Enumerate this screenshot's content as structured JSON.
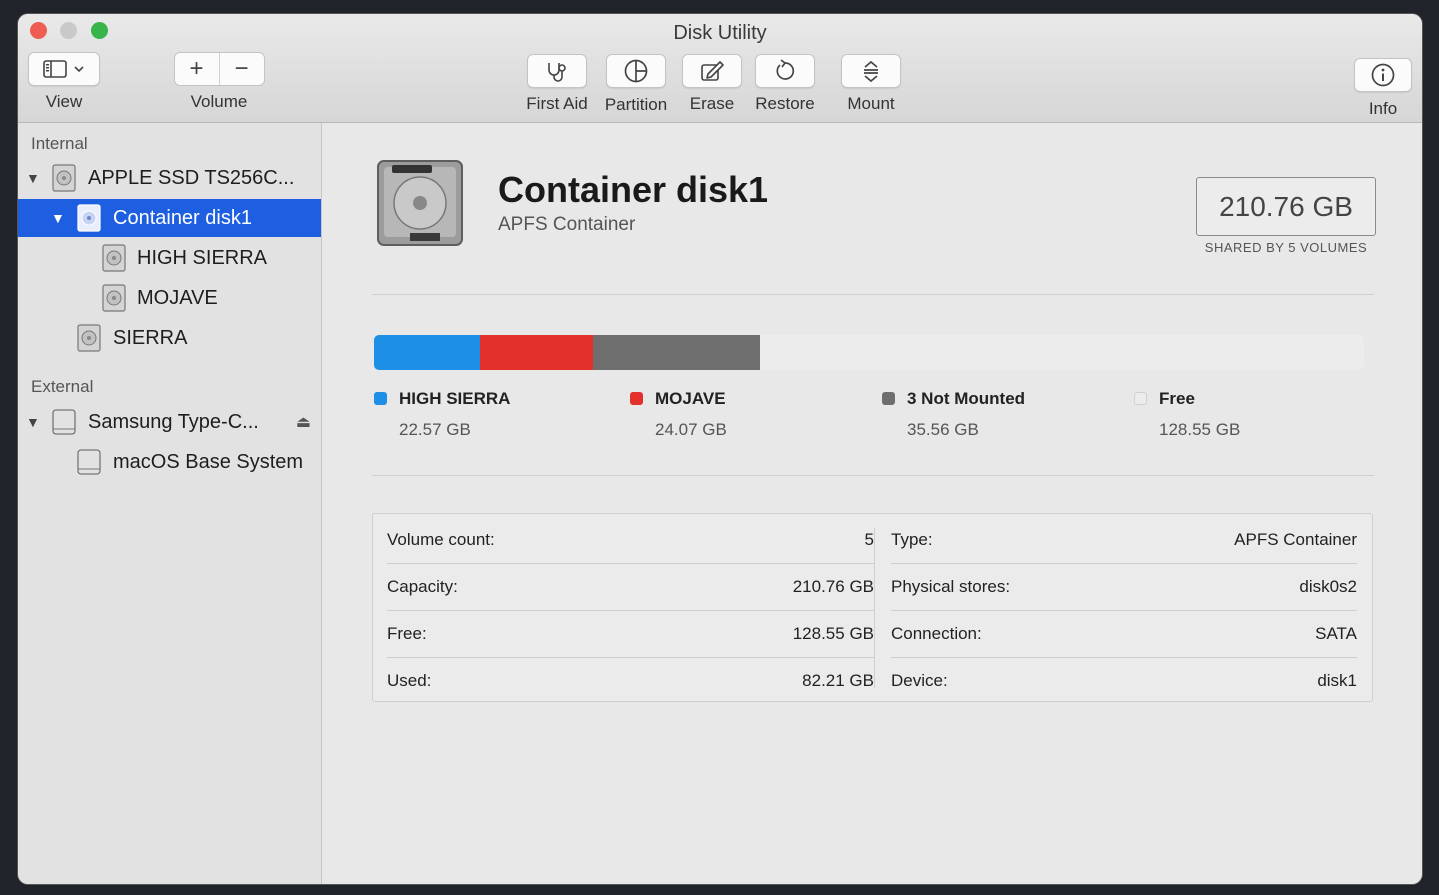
{
  "window": {
    "title": "Disk Utility"
  },
  "toolbar": {
    "view_label": "View",
    "volume_label": "Volume",
    "volume_add": "+",
    "volume_remove": "−",
    "first_aid_label": "First Aid",
    "partition_label": "Partition",
    "erase_label": "Erase",
    "restore_label": "Restore",
    "mount_label": "Mount",
    "info_label": "Info"
  },
  "sidebar": {
    "internal_header": "Internal",
    "external_header": "External",
    "items": [
      {
        "label": "APPLE SSD TS256C..."
      },
      {
        "label": "Container disk1"
      },
      {
        "label": "HIGH SIERRA"
      },
      {
        "label": "MOJAVE"
      },
      {
        "label": "SIERRA"
      },
      {
        "label": "Samsung Type-C..."
      },
      {
        "label": "macOS Base System"
      }
    ]
  },
  "header": {
    "name": "Container disk1",
    "subtitle": "APFS Container",
    "capacity": "210.76 GB",
    "capacity_note": "SHARED BY 5 VOLUMES"
  },
  "usage": {
    "total_gb": 210.76,
    "segments": [
      {
        "name": "HIGH SIERRA",
        "value": "22.57 GB",
        "gb": 22.57,
        "color": "#1e8fe6"
      },
      {
        "name": "MOJAVE",
        "value": "24.07 GB",
        "gb": 24.07,
        "color": "#e4302a"
      },
      {
        "name": "3 Not Mounted",
        "value": "35.56 GB",
        "gb": 35.56,
        "color": "#6e6e6e"
      },
      {
        "name": "Free",
        "value": "128.55 GB",
        "gb": 128.55,
        "color": "#ececec"
      }
    ]
  },
  "info": {
    "left": [
      {
        "label": "Volume count:",
        "value": "5"
      },
      {
        "label": "Capacity:",
        "value": "210.76 GB"
      },
      {
        "label": "Free:",
        "value": "128.55 GB"
      },
      {
        "label": "Used:",
        "value": "82.21 GB"
      }
    ],
    "right": [
      {
        "label": "Type:",
        "value": "APFS Container"
      },
      {
        "label": "Physical stores:",
        "value": "disk0s2"
      },
      {
        "label": "Connection:",
        "value": "SATA"
      },
      {
        "label": "Device:",
        "value": "disk1"
      }
    ]
  }
}
